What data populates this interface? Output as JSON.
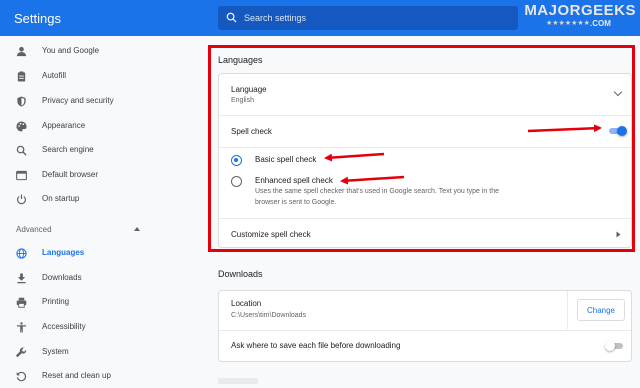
{
  "app": {
    "title": "Settings"
  },
  "search": {
    "placeholder": "Search settings"
  },
  "watermark": {
    "brand": "MAJORGEEKS",
    "stars": "★★★★★★★",
    "suffix": ".COM"
  },
  "sidebar": {
    "items": [
      {
        "label": "You and Google",
        "icon": "person-icon"
      },
      {
        "label": "Autofill",
        "icon": "clipboard-icon"
      },
      {
        "label": "Privacy and security",
        "icon": "shield-icon"
      },
      {
        "label": "Appearance",
        "icon": "palette-icon"
      },
      {
        "label": "Search engine",
        "icon": "search-icon"
      },
      {
        "label": "Default browser",
        "icon": "browser-icon"
      },
      {
        "label": "On startup",
        "icon": "power-icon"
      }
    ],
    "advanced": {
      "label": "Advanced"
    },
    "advanced_items": [
      {
        "label": "Languages",
        "icon": "globe-icon",
        "active": true
      },
      {
        "label": "Downloads",
        "icon": "download-icon"
      },
      {
        "label": "Printing",
        "icon": "printer-icon"
      },
      {
        "label": "Accessibility",
        "icon": "accessibility-icon"
      },
      {
        "label": "System",
        "icon": "wrench-icon"
      },
      {
        "label": "Reset and clean up",
        "icon": "reset-icon"
      }
    ]
  },
  "languages": {
    "title": "Languages",
    "language": {
      "label": "Language",
      "value": "English"
    },
    "spell_check": {
      "label": "Spell check",
      "enabled": true
    },
    "basic": {
      "label": "Basic spell check",
      "selected": true
    },
    "enhanced": {
      "label": "Enhanced spell check",
      "description_line1": "Uses the same spell checker that's used in Google search. Text you type in the",
      "description_line2": "browser is sent to Google.",
      "selected": false
    },
    "customize": {
      "label": "Customize spell check"
    }
  },
  "downloads": {
    "title": "Downloads",
    "location": {
      "label": "Location",
      "value": "C:\\Users\\tim\\Downloads"
    },
    "change_button": "Change",
    "ask": {
      "label": "Ask where to save each file before downloading",
      "enabled": false
    }
  },
  "colors": {
    "accent": "#1a73e8",
    "header": "#1a73e8",
    "annotation": "#e3000b",
    "active_text": "#1a73e8"
  }
}
